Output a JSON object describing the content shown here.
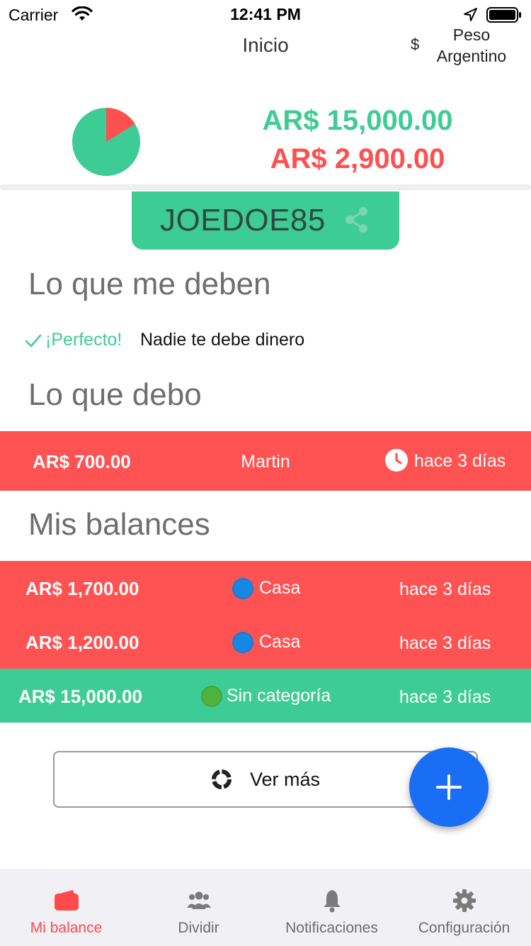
{
  "status_bar": {
    "carrier": "Carrier",
    "time": "12:41 PM"
  },
  "header": {
    "title": "Inicio",
    "currency_symbol": "$",
    "currency_label": "Peso Argentino"
  },
  "summary": {
    "credit": "AR$ 15,000.00",
    "debit": "AR$ 2,900.00",
    "pie": {
      "credit_value": 15000,
      "debit_value": 2900,
      "credit_color": "#3ECC96",
      "debit_color": "#FF5050"
    }
  },
  "user": {
    "username": "JOEDOE85"
  },
  "owed": {
    "title": "Lo que me deben",
    "perfect": "¡Perfecto!",
    "nobody": "Nadie te debe dinero"
  },
  "debts": {
    "title": "Lo que debo",
    "items": [
      {
        "amount": "AR$ 700.00",
        "person": "Martin",
        "time": "hace 3 días"
      }
    ]
  },
  "balances": {
    "title": "Mis balances",
    "items": [
      {
        "amount": "AR$ 1,700.00",
        "category": "Casa",
        "time": "hace 3 días",
        "color": "#FF5252",
        "dot_color": "#1787E3"
      },
      {
        "amount": "AR$ 1,200.00",
        "category": "Casa",
        "time": "hace 3 días",
        "color": "#FF5252",
        "dot_color": "#1787E3"
      },
      {
        "amount": "AR$ 15,000.00",
        "category": "Sin categoría",
        "time": "hace 3 días",
        "color": "#3ECC96",
        "dot_color": "#4CB33F"
      }
    ]
  },
  "more_button": {
    "label": "Ver más"
  },
  "tabs": [
    {
      "label": "Mi balance",
      "icon": "wallet-icon",
      "active": true
    },
    {
      "label": "Dividir",
      "icon": "people-icon",
      "active": false
    },
    {
      "label": "Notificaciones",
      "icon": "bell-icon",
      "active": false
    },
    {
      "label": "Configuración",
      "icon": "gear-icon",
      "active": false
    }
  ],
  "colors": {
    "green": "#3ECC96",
    "red": "#FF5252",
    "fab": "#1A6EF5",
    "active_tab": "#FF4B4B"
  }
}
